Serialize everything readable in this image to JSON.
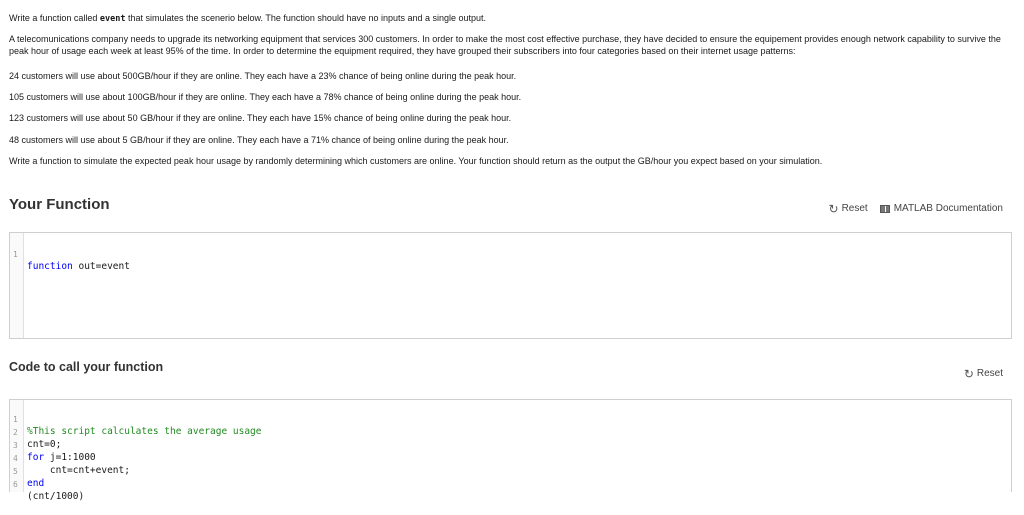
{
  "problem": {
    "intro_prefix": "Write a function called ",
    "intro_fn": "event",
    "intro_suffix": " that simulates the scenerio below. The function should have no inputs and a single output.",
    "company": "A telecomunications company needs to upgrade its networking equipment that services 300 customers. In order to make the most cost effective purchase, they have decided to ensure the equipement provides enough network capability to survive the peak hour of usage each week at least 95% of the time. In order to determine the equipment required, they have grouped their subscribers into four categories based on their internet usage patterns:",
    "group1": "24 customers will use about 500GB/hour if they are online. They each have a 23% chance of being online during the peak hour.",
    "group2": "105 customers will use about 100GB/hour if they are online. They each have a 78% chance of being online during the peak hour.",
    "group3": "123 customers will use about 50 GB/hour if they are online. They each have 15% chance of being online during the peak hour.",
    "group4": "48 customers will use about 5 GB/hour if they are online. They each have a 71% chance of being online during the peak hour.",
    "task": "Write a function to simulate the expected peak hour usage by randomly determining which customers are online. Your function should return as the output the GB/hour you expect based on your simulation."
  },
  "your_function": {
    "title": "Your Function",
    "reset_label": "Reset",
    "reset_icon": "↻",
    "doc_label": "MATLAB Documentation",
    "lines": [
      {
        "num": "1",
        "kw": "function",
        "text": " out=event"
      }
    ]
  },
  "call_function": {
    "title": "Code to call your function",
    "reset_label": "Reset",
    "reset_icon": "↻",
    "lines": [
      {
        "num": "1",
        "comment": "%This script calculates the average usage"
      },
      {
        "num": "2",
        "text": "cnt=0;"
      },
      {
        "num": "3",
        "kw": "for",
        "text": " j=1:1000"
      },
      {
        "num": "4",
        "text": "    cnt=cnt+event;"
      },
      {
        "num": "5",
        "kw": "end"
      },
      {
        "num": "6",
        "text": "(cnt/1000)"
      }
    ]
  },
  "colors": {
    "keyword": "#0000ff",
    "comment": "#228b22",
    "border": "#cfcfcf"
  }
}
